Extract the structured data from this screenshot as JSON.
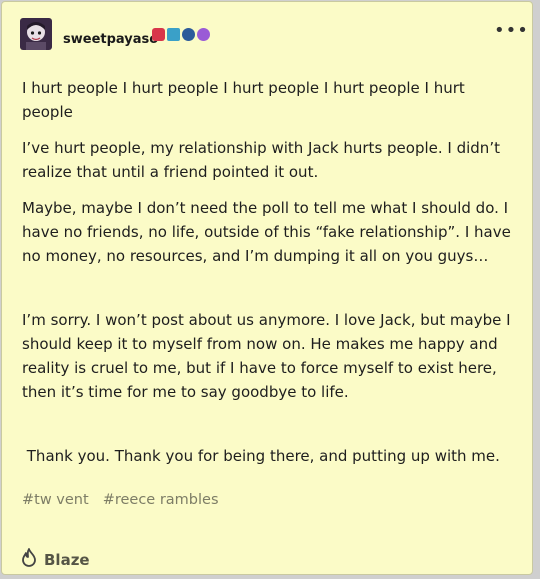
{
  "post": {
    "username": "sweetpayaso",
    "more_glyph": "•••",
    "paragraphs": [
      "I hurt people I hurt people I hurt people I hurt people I hurt people",
      "I’ve hurt people, my relationship with Jack hurts people. I didn’t realize that until a friend pointed it out.",
      "Maybe, maybe I don’t need the poll to tell me what I should do. I have no friends, no life, outside of this “fake relationship”. I have no money, no resources, and I’m dumping it all on you guys…",
      "I’m sorry. I won’t post about us anymore. I love Jack, but maybe I should keep it to myself from now on. He makes me happy and reality is cruel to me, but if I have to force myself to exist here, then it’s time for me to say goodbye to life.",
      " Thank you. Thank you for being there, and putting up with me."
    ],
    "tags": [
      "#tw vent",
      "#reece rambles"
    ],
    "blaze_label": "Blaze",
    "badge_colors": [
      "#d8364a",
      "#3aa0c8",
      "#2d5b9a",
      "#9a5bd6"
    ]
  }
}
